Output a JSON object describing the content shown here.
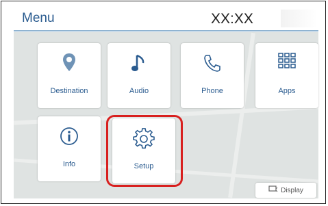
{
  "header": {
    "title": "Menu",
    "clock": "XX:XX"
  },
  "tiles": [
    {
      "label": "Destination",
      "icon": "location-pin-icon"
    },
    {
      "label": "Audio",
      "icon": "music-note-icon"
    },
    {
      "label": "Phone",
      "icon": "phone-icon"
    },
    {
      "label": "Apps",
      "icon": "apps-grid-icon"
    },
    {
      "label": "Info",
      "icon": "info-icon"
    },
    {
      "label": "Setup",
      "icon": "gear-icon"
    }
  ],
  "display_button": {
    "label": "Display",
    "icon": "display-icon"
  },
  "colors": {
    "accent": "#2a5b8f",
    "highlight": "#d8201f",
    "map_bg": "#dfe3e2"
  }
}
